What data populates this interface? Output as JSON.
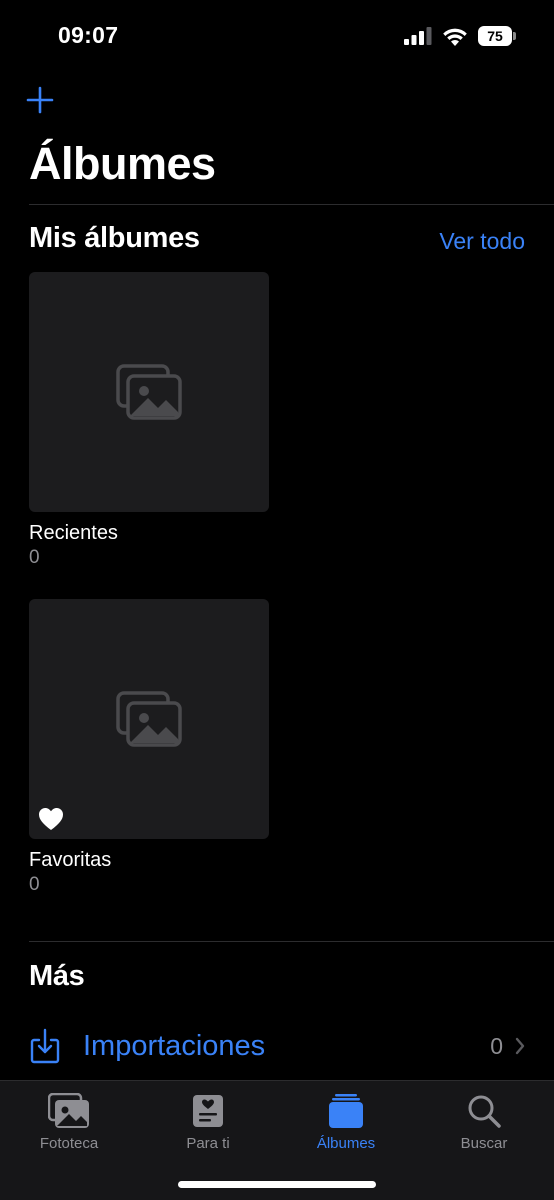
{
  "status": {
    "time": "09:07",
    "battery": "75"
  },
  "header": {
    "title": "Álbumes"
  },
  "my_albums": {
    "title": "Mis álbumes",
    "see_all_label": "Ver todo",
    "albums": [
      {
        "name": "Recientes",
        "count": "0"
      },
      {
        "name": "Favoritas",
        "count": "0"
      }
    ]
  },
  "more": {
    "title": "Más",
    "rows": [
      {
        "label": "Importaciones",
        "count": "0"
      }
    ]
  },
  "tab_bar": {
    "tabs": [
      {
        "label": "Fototeca",
        "icon": "photo-library-icon"
      },
      {
        "label": "Para ti",
        "icon": "for-you-icon"
      },
      {
        "label": "Álbumes",
        "icon": "albums-icon",
        "active": true
      },
      {
        "label": "Buscar",
        "icon": "search-icon"
      }
    ]
  },
  "colors": {
    "accent": "#3a82f7",
    "background": "#000000",
    "thumb": "#1c1c1e",
    "secondary_text": "#8e8e93"
  }
}
